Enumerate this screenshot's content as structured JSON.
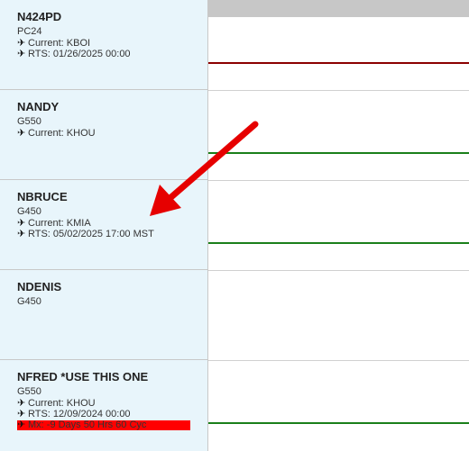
{
  "aircraft": [
    {
      "tail": "N424PD",
      "type": "PC24",
      "current": "Current: KBOI",
      "rts": "RTS: 01/26/2025 00:00",
      "timeline_color": "#8b0000"
    },
    {
      "tail": "NANDY",
      "type": "G550",
      "current": "Current: KHOU",
      "timeline_color": "#1a7f1a"
    },
    {
      "tail": "NBRUCE",
      "type": "G450",
      "current": "Current: KMIA",
      "rts": "RTS: 05/02/2025 17:00 MST",
      "timeline_color": "#1a7f1a"
    },
    {
      "tail": "NDENIS",
      "type": "G450"
    },
    {
      "tail": "NFRED *USE THIS ONE",
      "type": "G550",
      "current": "Current: KHOU",
      "rts": "RTS: 12/09/2024 00:00",
      "mx": "Mx: -9 Days 50 Hrs 60 Cyc",
      "mx_color": "#ff0000",
      "timeline_color": "#1a7f1a"
    }
  ],
  "icons": {
    "plane": "airplane-icon",
    "annotation": "red-arrow-annotation"
  }
}
